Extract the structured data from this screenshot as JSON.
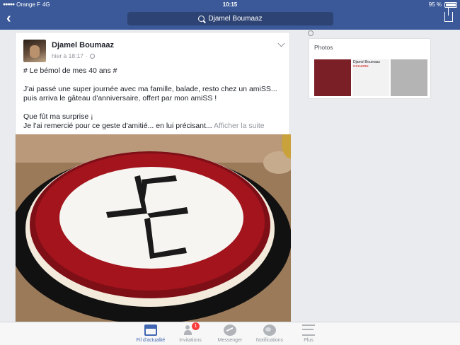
{
  "status_bar": {
    "carrier": "Orange F",
    "network": "4G",
    "time": "10:15",
    "battery": "95 %"
  },
  "nav": {
    "search_text": "Djamel Boumaaz",
    "back_icon": "chevron-left-icon",
    "share_icon": "share-icon"
  },
  "post": {
    "author": "Djamel Boumaaz",
    "timestamp": "hier à 18:17",
    "dot": "·",
    "title_line": "# Le bémol de mes 40 ans #",
    "paragraph1": "J'ai passé une super journée avec ma famille, balade, resto chez un amiSS... puis arriva le gâteau d'anniversaire, offert par mon amiSS !",
    "line3": "Que fût ma surprise ¡",
    "line4": "Je l'ai remercié pour ce geste d'amitié... en lui précisant...",
    "see_more": "Afficher la suite"
  },
  "photos_panel": {
    "title": "Photos",
    "thumb2_caption": "Djamel Boumaaz",
    "thumb2_caption2": "#JHAMON"
  },
  "tabbar": {
    "tabs": [
      {
        "label": "Fil d'actualité",
        "icon": "news-feed-icon",
        "active": true
      },
      {
        "label": "Invitations",
        "icon": "friend-requests-icon",
        "badge": "1"
      },
      {
        "label": "Messenger",
        "icon": "messenger-icon"
      },
      {
        "label": "Notifications",
        "icon": "globe-icon"
      },
      {
        "label": "Plus",
        "icon": "menu-icon"
      }
    ]
  },
  "colors": {
    "brand_blue": "#3b5998",
    "active_blue": "#4267b2",
    "badge_red": "#fa3e3e"
  }
}
